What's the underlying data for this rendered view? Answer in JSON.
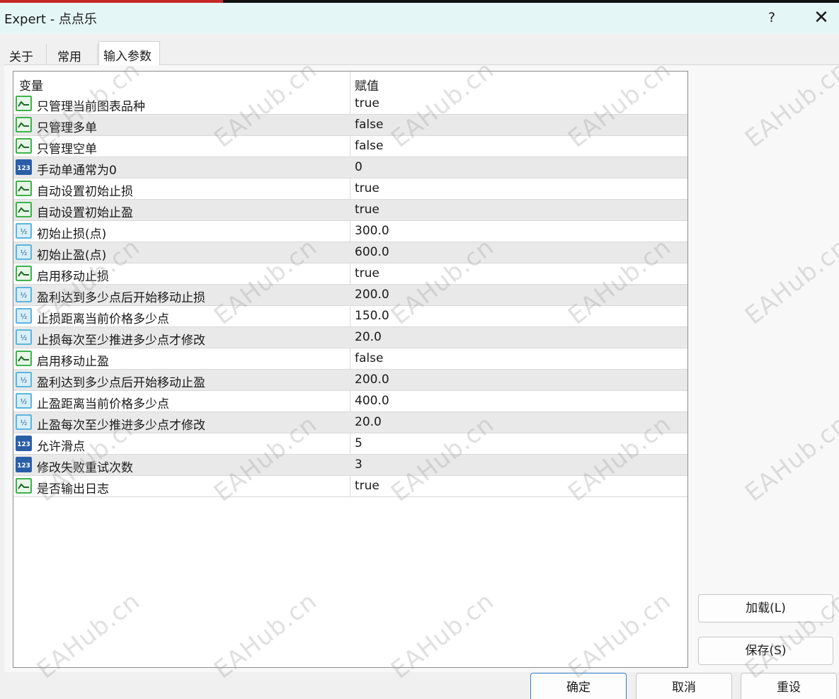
{
  "window": {
    "title": "Expert - 点点乐",
    "help": "?",
    "close": "✕"
  },
  "tabs": [
    {
      "label": "关于",
      "active": false
    },
    {
      "label": "常用",
      "active": false
    },
    {
      "label": "输入参数",
      "active": true
    }
  ],
  "grid": {
    "columns": {
      "variable": "变量",
      "value": "赋值"
    },
    "rows": [
      {
        "name": "只管理当前图表品种",
        "value": "true",
        "type": "bool"
      },
      {
        "name": "只管理多单",
        "value": "false",
        "type": "bool"
      },
      {
        "name": "只管理空单",
        "value": "false",
        "type": "bool"
      },
      {
        "name": "手动单通常为0",
        "value": "0",
        "type": "int"
      },
      {
        "name": "自动设置初始止损",
        "value": "true",
        "type": "bool"
      },
      {
        "name": "自动设置初始止盈",
        "value": "true",
        "type": "bool"
      },
      {
        "name": "初始止损(点)",
        "value": "300.0",
        "type": "double"
      },
      {
        "name": "初始止盈(点)",
        "value": "600.0",
        "type": "double"
      },
      {
        "name": "启用移动止损",
        "value": "true",
        "type": "bool"
      },
      {
        "name": "盈利达到多少点后开始移动止损",
        "value": "200.0",
        "type": "double"
      },
      {
        "name": "止损距离当前价格多少点",
        "value": "150.0",
        "type": "double"
      },
      {
        "name": "止损每次至少推进多少点才修改",
        "value": "20.0",
        "type": "double"
      },
      {
        "name": "启用移动止盈",
        "value": "false",
        "type": "bool"
      },
      {
        "name": "盈利达到多少点后开始移动止盈",
        "value": "200.0",
        "type": "double"
      },
      {
        "name": "止盈距离当前价格多少点",
        "value": "400.0",
        "type": "double"
      },
      {
        "name": "止盈每次至少推进多少点才修改",
        "value": "20.0",
        "type": "double"
      },
      {
        "name": "允许滑点",
        "value": "5",
        "type": "int"
      },
      {
        "name": "修改失败重试次数",
        "value": "3",
        "type": "int"
      },
      {
        "name": "是否输出日志",
        "value": "true",
        "type": "bool"
      }
    ]
  },
  "buttons": {
    "load": "加载(L)",
    "save": "保存(S)",
    "ok": "确定",
    "cancel": "取消",
    "reset": "重设"
  },
  "watermark": "EAHub.cn",
  "colors": {
    "title_bg": "#e5f6f7",
    "bool_icon": "#3db34a",
    "int_icon": "#2a5fa8",
    "double_icon": "#5bb5e0",
    "row_alt": "#e9e9e9",
    "ok_border": "#2e7dc8"
  }
}
